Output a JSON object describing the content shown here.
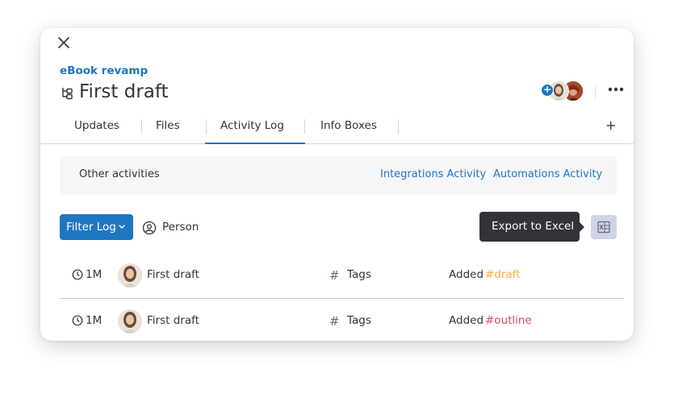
{
  "breadcrumb": "eBook revamp",
  "title": "First draft",
  "tabs": [
    {
      "label": "Updates"
    },
    {
      "label": "Files"
    },
    {
      "label": "Activity Log"
    },
    {
      "label": "Info Boxes"
    }
  ],
  "tab_add": "+",
  "activities": {
    "label": "Other activities",
    "integrations": "Integrations Activity",
    "automations": "Automations Activity"
  },
  "filter": {
    "label": "Filter Log",
    "person": "Person"
  },
  "tooltip": "Export to Excel",
  "rows": [
    {
      "time": "1M",
      "item": "First draft",
      "column": "Tags",
      "action": "Added",
      "tag": "#draft",
      "tag_color": "#fdab3d"
    },
    {
      "time": "1M",
      "item": "First draft",
      "column": "Tags",
      "action": "Added",
      "tag": "#outline",
      "tag_color": "#e2445c"
    }
  ],
  "colors": {
    "accent": "#1f76c2",
    "tooltip_bg": "#323338",
    "panel_bg": "#f5f6f8"
  },
  "icons": [
    "close-icon",
    "subitems-icon",
    "add-person-icon",
    "more-icon",
    "chevron-down-icon",
    "person-icon",
    "excel-icon",
    "clock-icon",
    "hash-icon"
  ]
}
